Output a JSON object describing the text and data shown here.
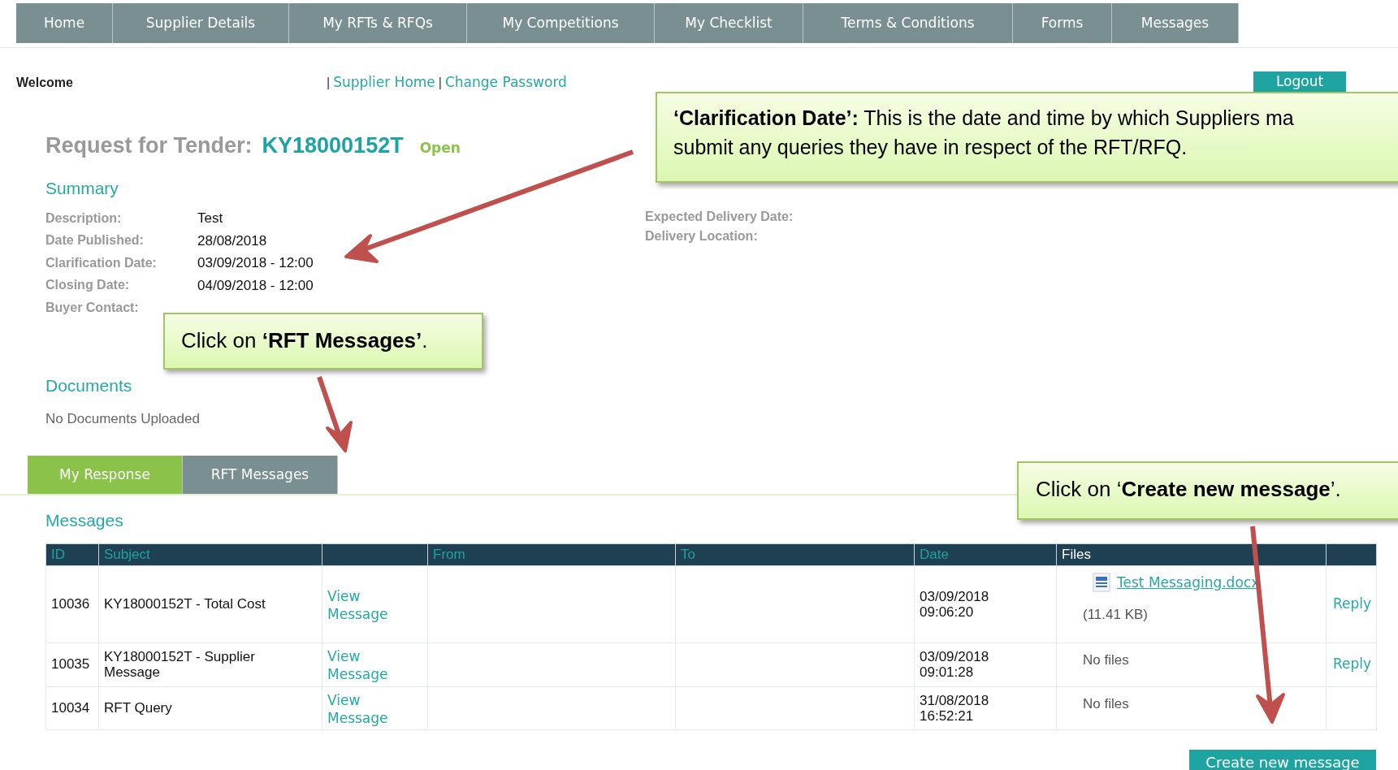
{
  "nav": [
    "Home",
    "Supplier Details",
    "My RFTs & RFQs",
    "My Competitions",
    "My Checklist",
    "Terms & Conditions",
    "Forms",
    "Messages"
  ],
  "welcome": "Welcome",
  "header_links": [
    {
      "kind": "separator",
      "text": "|"
    },
    {
      "kind": "link",
      "text": "Supplier Home"
    },
    {
      "kind": "separator",
      "text": "|"
    },
    {
      "kind": "link",
      "text": "Change Password"
    }
  ],
  "logout": "Logout",
  "tender": {
    "prefix": "Request for Tender:",
    "ref": "KY18000152T",
    "status": "Open"
  },
  "summary": {
    "heading": "Summary",
    "fields": [
      {
        "label": "Description:",
        "value": "Test"
      },
      {
        "label": "Date Published:",
        "value": "28/08/2018"
      },
      {
        "label": "Clarification Date:",
        "value": "03/09/2018 - 12:00"
      },
      {
        "label": "Closing Date:",
        "value": "04/09/2018 - 12:00"
      },
      {
        "label": "Buyer Contact:"
      }
    ],
    "side_fields": [
      {
        "label": "Expected Delivery Date:"
      },
      {
        "label": "Delivery Location:"
      }
    ]
  },
  "documents": {
    "heading": "Documents",
    "empty_text": "No Documents Uploaded"
  },
  "tabs": [
    {
      "label": "My Response",
      "selected": true
    },
    {
      "label": "RFT Messages",
      "selected": false
    }
  ],
  "messages": {
    "heading": "Messages",
    "columns": [
      {
        "label": "ID",
        "sortable": true
      },
      {
        "label": "Subject",
        "sortable": true
      },
      {},
      {
        "label": "From",
        "sortable": true
      },
      {
        "label": "To",
        "sortable": true
      },
      {
        "label": "Date",
        "sortable": true
      },
      {
        "label": "Files",
        "sortable": false
      },
      {}
    ],
    "rows": [
      {
        "id": "10036",
        "subject": "KY18000152T - Total Cost",
        "action": "View\nMessage",
        "date": "03/09/2018\n09:06:20",
        "files": [
          {
            "name": "Test Messaging.docx",
            "size": "(11.41 KB)"
          }
        ],
        "reply": "Reply"
      },
      {
        "id": "10035",
        "subject": "KY18000152T - Supplier\nMessage",
        "action": "View\nMessage",
        "date": "03/09/2018\n09:01:28",
        "files_text": "No files",
        "reply": "Reply"
      },
      {
        "id": "10034",
        "subject": "RFT Query",
        "action": "View\nMessage",
        "date": "31/08/2018\n16:52:21",
        "files_text": "No files"
      }
    ]
  },
  "create_button": "Create new message",
  "callouts": [
    {
      "lines": [
        "**‘Clarification Date’:** This is the date and time by which Suppliers ma",
        "submit any queries they have in respect of the RFT/RFQ."
      ]
    },
    {
      "lines": [
        "Click on **‘RFT Messages’**."
      ]
    },
    {
      "lines": [
        "Click on ‘**Create new message**’."
      ]
    }
  ]
}
